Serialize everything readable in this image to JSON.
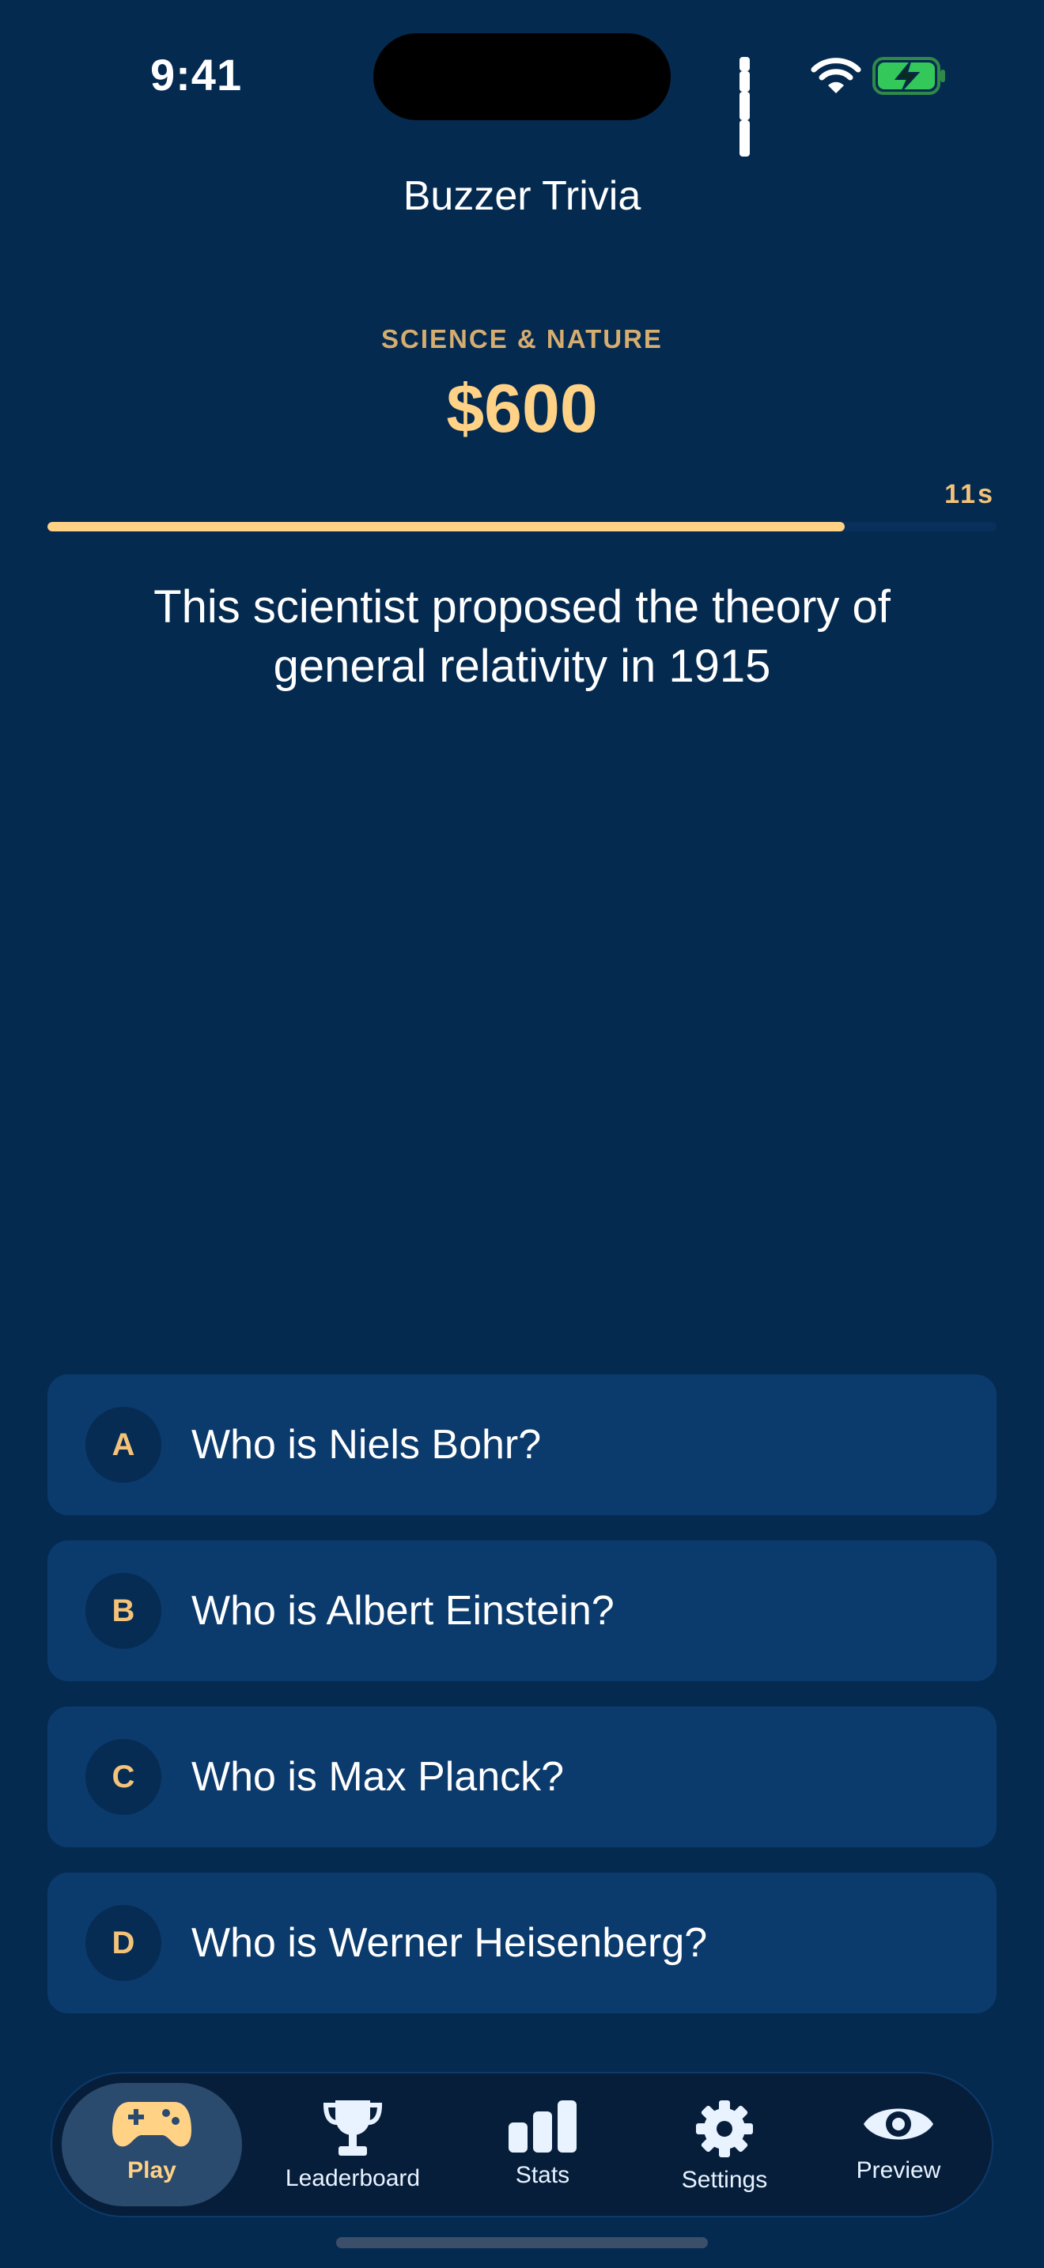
{
  "status_bar": {
    "time": "9:41",
    "icons": [
      "cellular-signal-icon",
      "wifi-icon",
      "battery-charging-icon"
    ]
  },
  "header": {
    "title": "Buzzer Trivia"
  },
  "clue": {
    "category": "SCIENCE & NATURE",
    "value": "$600",
    "timer_label": "11s",
    "time_remaining_fraction": 0.84,
    "question": "This scientist proposed the theory of general relativity in 1915"
  },
  "answers": [
    {
      "letter": "A",
      "text": "Who is Niels Bohr?"
    },
    {
      "letter": "B",
      "text": "Who is Albert Einstein?"
    },
    {
      "letter": "C",
      "text": "Who is Max Planck?"
    },
    {
      "letter": "D",
      "text": "Who is Werner Heisenberg?"
    }
  ],
  "tabbar": {
    "tabs": [
      {
        "label": "Play",
        "icon": "gamepad-icon",
        "active": true
      },
      {
        "label": "Leaderboard",
        "icon": "trophy-icon",
        "active": false
      },
      {
        "label": "Stats",
        "icon": "bar-chart-icon",
        "active": false
      },
      {
        "label": "Settings",
        "icon": "gear-icon",
        "active": false
      },
      {
        "label": "Preview",
        "icon": "eye-icon",
        "active": false
      }
    ]
  },
  "colors": {
    "background": "#052a50",
    "accent": "#ffd286",
    "answer_card": "#0b3a6c",
    "tabbar": "#071e3a",
    "battery_fill": "#34c759"
  }
}
